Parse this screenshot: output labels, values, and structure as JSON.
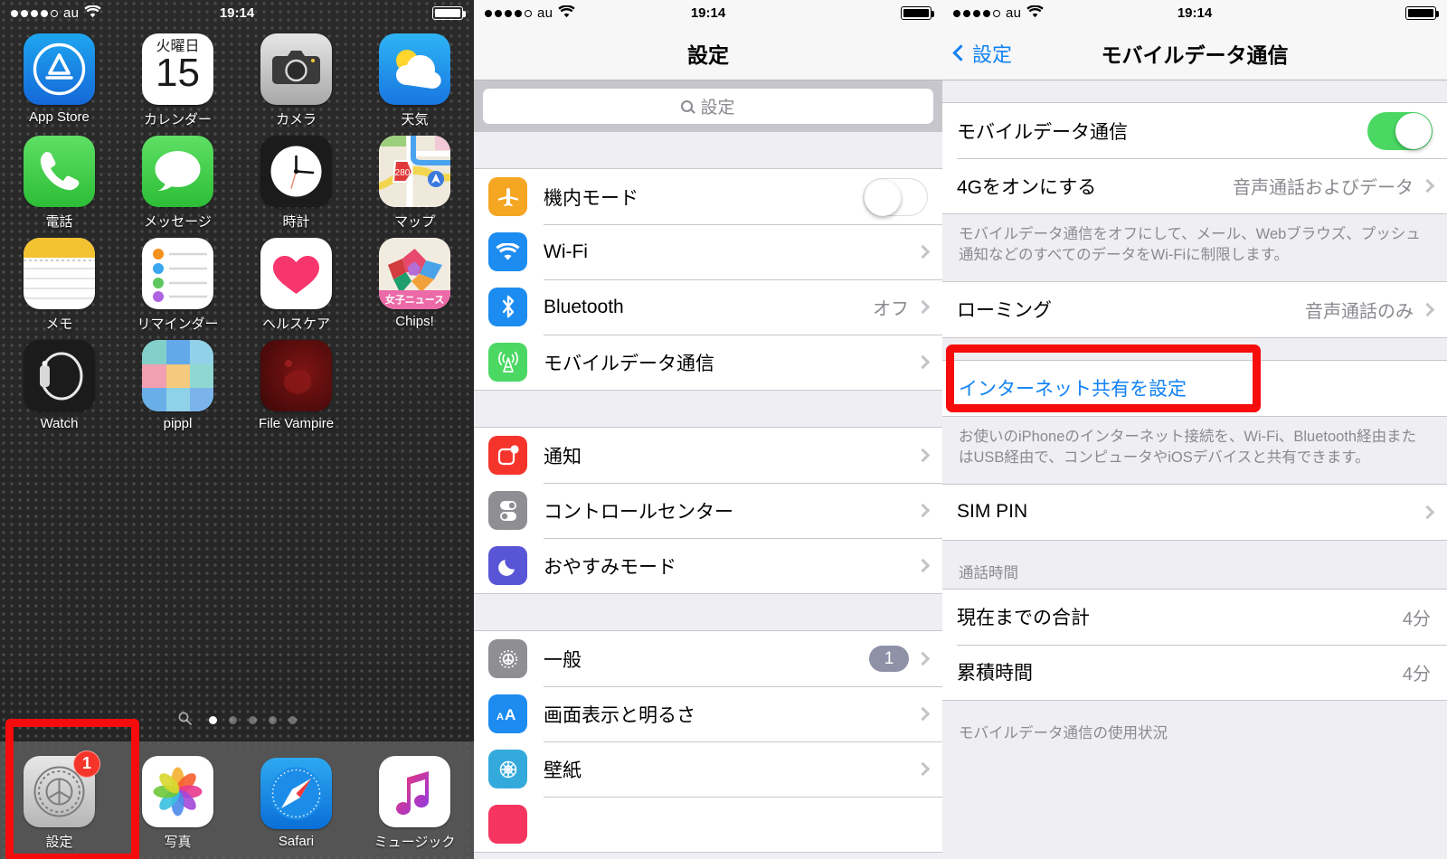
{
  "home": {
    "statusbar": {
      "carrier": "au",
      "signal_dots_filled": 4,
      "signal_dots_total": 5,
      "wifi_icon": "wifi-icon",
      "time": "19:14",
      "battery_icon": "battery-full-icon"
    },
    "apps": [
      {
        "label": "App Store",
        "icon": "appstore-icon"
      },
      {
        "label": "カレンダー",
        "icon": "calendar-icon",
        "dow": "火曜日",
        "day": "15"
      },
      {
        "label": "カメラ",
        "icon": "camera-icon"
      },
      {
        "label": "天気",
        "icon": "weather-icon"
      },
      {
        "label": "電話",
        "icon": "phone-icon"
      },
      {
        "label": "メッセージ",
        "icon": "messages-icon"
      },
      {
        "label": "時計",
        "icon": "clock-icon"
      },
      {
        "label": "マップ",
        "icon": "maps-icon",
        "badge_text": "280"
      },
      {
        "label": "メモ",
        "icon": "notes-icon"
      },
      {
        "label": "リマインダー",
        "icon": "reminders-icon"
      },
      {
        "label": "ヘルスケア",
        "icon": "health-icon"
      },
      {
        "label": "Chips!",
        "icon": "chips-icon",
        "ribbon": "女子ニュース"
      },
      {
        "label": "Watch",
        "icon": "watch-icon"
      },
      {
        "label": "pippl",
        "icon": "pippl-icon"
      },
      {
        "label": "File Vampire",
        "icon": "filevampire-icon"
      }
    ],
    "pagedots": {
      "search_icon": "search-icon",
      "total": 5,
      "active_index": 1
    },
    "dock": [
      {
        "label": "設定",
        "icon": "settings-gear-icon",
        "badge": "1",
        "highlighted": true
      },
      {
        "label": "写真",
        "icon": "photos-icon"
      },
      {
        "label": "Safari",
        "icon": "safari-compass-icon"
      },
      {
        "label": "ミュージック",
        "icon": "music-note-icon"
      }
    ]
  },
  "settings": {
    "statusbar": {
      "carrier": "au",
      "wifi_icon": "wifi-icon",
      "time": "19:14",
      "battery_icon": "battery-full-icon"
    },
    "navtitle": "設定",
    "search": {
      "placeholder": "設定",
      "value": "",
      "icon": "search-icon"
    },
    "group1": [
      {
        "label": "機内モード",
        "icon": "airplane-icon",
        "icon_color": "#f5a623",
        "control": "toggle-off"
      },
      {
        "label": "Wi-Fi",
        "icon": "wifi-icon",
        "icon_color": "#1d8cf0",
        "control": "chevron"
      },
      {
        "label": "Bluetooth",
        "icon": "bluetooth-icon",
        "icon_color": "#1d8cf0",
        "value": "オフ",
        "control": "chevron"
      },
      {
        "label": "モバイルデータ通信",
        "icon": "cellular-antenna-icon",
        "icon_color": "#4ad863",
        "control": "chevron",
        "highlighted": true
      }
    ],
    "group2": [
      {
        "label": "通知",
        "icon": "notifications-icon",
        "icon_color": "#f5352b",
        "control": "chevron"
      },
      {
        "label": "コントロールセンター",
        "icon": "control-center-icon",
        "icon_color": "#8e8e93",
        "control": "chevron"
      },
      {
        "label": "おやすみモード",
        "icon": "moon-icon",
        "icon_color": "#5856d6",
        "control": "chevron"
      }
    ],
    "group3": [
      {
        "label": "一般",
        "icon": "general-gear-icon",
        "icon_color": "#8e8e93",
        "badge": "1",
        "control": "chevron"
      },
      {
        "label": "画面表示と明るさ",
        "icon": "display-aa-icon",
        "icon_color": "#1d8cf0",
        "control": "chevron"
      },
      {
        "label": "壁紙",
        "icon": "wallpaper-icon",
        "icon_color": "#34aadc",
        "control": "chevron"
      },
      {
        "label": "",
        "icon": "sounds-icon",
        "icon_color": "#f5355f",
        "control": "none"
      }
    ]
  },
  "detail": {
    "statusbar": {
      "carrier": "au",
      "wifi_icon": "wifi-icon",
      "time": "19:14",
      "battery_icon": "battery-full-icon"
    },
    "back_label": "設定",
    "back_icon": "chevron-left-icon",
    "navtitle": "モバイルデータ通信",
    "cellular_row": {
      "label": "モバイルデータ通信",
      "toggle": "on",
      "highlighted": true
    },
    "fourg_row": {
      "label": "4Gをオンにする",
      "value": "音声通話およびデータ"
    },
    "footnote1": "モバイルデータ通信をオフにして、メール、Webブラウズ、プッシュ通知などのすべてのデータをWi-Fiに制限します。",
    "roaming_row": {
      "label": "ローミング",
      "value": "音声通話のみ"
    },
    "hotspot_link": "インターネット共有を設定",
    "footnote2": "お使いのiPhoneのインターネット接続を、Wi-Fi、Bluetooth経由またはUSB経由で、コンピュータやiOSデバイスと共有できます。",
    "simpin_row": {
      "label": "SIM PIN"
    },
    "calltime_header": "通話時間",
    "calltime_rows": [
      {
        "label": "現在までの合計",
        "value": "4分"
      },
      {
        "label": "累積時間",
        "value": "4分"
      }
    ],
    "usage_header": "モバイルデータ通信の使用状況"
  },
  "annotations": {
    "accent_color": "#f60c0c",
    "boxes": [
      {
        "name": "dock-settings-highlight"
      },
      {
        "name": "cellular-row-highlight"
      },
      {
        "name": "cellular-toggle-highlight"
      }
    ]
  }
}
